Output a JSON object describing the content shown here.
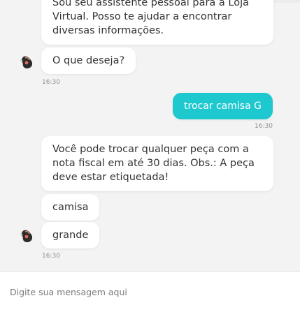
{
  "messages": [
    {
      "text": "Sou seu assistente pessoal para a Loja Virtual. Posso te ajudar a encontrar diversas informações."
    },
    {
      "text": "O que deseja?"
    },
    {
      "text": "16:30"
    },
    {
      "text": "trocar camisa G"
    },
    {
      "text": "16:30"
    },
    {
      "text": "Você pode trocar qualquer peça com a nota fiscal em até 30 dias. Obs.: A peça deve estar etiquetada!"
    },
    {
      "text": "camisa"
    },
    {
      "text": "grande"
    },
    {
      "text": "16:30"
    }
  ],
  "input": {
    "placeholder": "Digite sua mensagem aqui"
  },
  "colors": {
    "user_bubble": "#1ec8cf",
    "background": "#f3f3f3"
  },
  "icons": {
    "bot_avatar": "bot-avatar-icon"
  }
}
